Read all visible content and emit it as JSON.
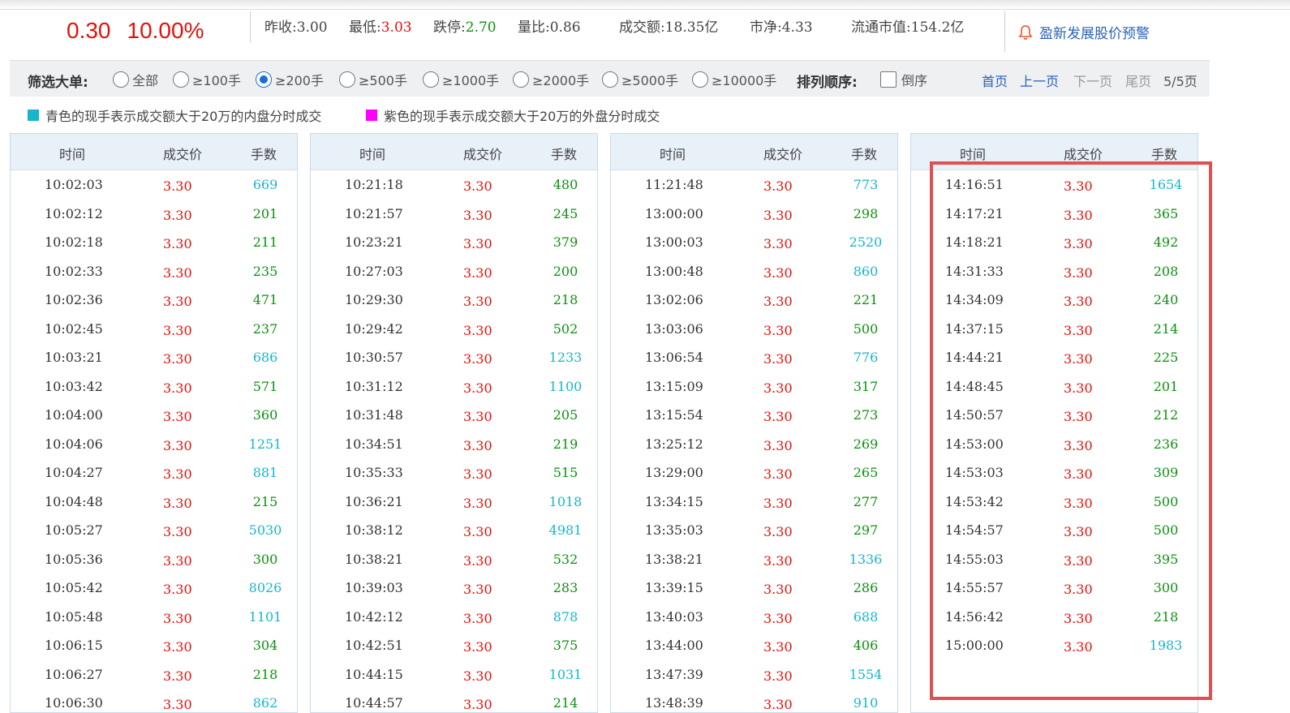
{
  "quote": {
    "change": "0.30",
    "change_pct": "10.00%"
  },
  "stats": {
    "prev_close_label": "昨收:",
    "prev_close": "3.00",
    "low_label": "最低:",
    "low": "3.03",
    "limit_down_label": "跌停:",
    "limit_down": "2.70",
    "volume_ratio_label": "量比:",
    "volume_ratio": "0.86",
    "turnover_label": "成交额:",
    "turnover": "18.35亿",
    "pb_label": "市净:",
    "pb": "4.33",
    "float_cap_label": "流通市值:",
    "float_cap": "154.2亿"
  },
  "alert": {
    "label": "盈新发展股价预警",
    "icon": "bell-icon"
  },
  "filter": {
    "label": "筛选大单:",
    "options": [
      "全部",
      "≥100手",
      "≥200手",
      "≥500手",
      "≥1000手",
      "≥2000手",
      "≥5000手",
      "≥10000手"
    ],
    "selected_index": 2,
    "sort_label": "排列顺序:",
    "reverse_label": "倒序"
  },
  "pager": {
    "first": "首页",
    "prev": "上一页",
    "next": "下一页",
    "last": "尾页",
    "info": "5/5页"
  },
  "legend": {
    "cyan": "青色的现手表示成交额大于20万的内盘分时成交",
    "magenta": "紫色的现手表示成交额大于20万的外盘分时成交"
  },
  "colors": {
    "red": "#e4110b",
    "green": "#0c9010",
    "cyan": "#17b5c9",
    "magenta": "#ff00ff",
    "link": "#2a62b7",
    "highlight": "#e0504e"
  },
  "headers": {
    "time": "时间",
    "price": "成交价",
    "volume": "手数"
  },
  "panels": [
    {
      "rows": [
        {
          "time": "10:02:03",
          "price": "3.30",
          "vol": "669",
          "c": "cyan"
        },
        {
          "time": "10:02:12",
          "price": "3.30",
          "vol": "201",
          "c": "green"
        },
        {
          "time": "10:02:18",
          "price": "3.30",
          "vol": "211",
          "c": "green"
        },
        {
          "time": "10:02:33",
          "price": "3.30",
          "vol": "235",
          "c": "green"
        },
        {
          "time": "10:02:36",
          "price": "3.30",
          "vol": "471",
          "c": "green"
        },
        {
          "time": "10:02:45",
          "price": "3.30",
          "vol": "237",
          "c": "green"
        },
        {
          "time": "10:03:21",
          "price": "3.30",
          "vol": "686",
          "c": "cyan"
        },
        {
          "time": "10:03:42",
          "price": "3.30",
          "vol": "571",
          "c": "green"
        },
        {
          "time": "10:04:00",
          "price": "3.30",
          "vol": "360",
          "c": "green"
        },
        {
          "time": "10:04:06",
          "price": "3.30",
          "vol": "1251",
          "c": "cyan"
        },
        {
          "time": "10:04:27",
          "price": "3.30",
          "vol": "881",
          "c": "cyan"
        },
        {
          "time": "10:04:48",
          "price": "3.30",
          "vol": "215",
          "c": "green"
        },
        {
          "time": "10:05:27",
          "price": "3.30",
          "vol": "5030",
          "c": "cyan"
        },
        {
          "time": "10:05:36",
          "price": "3.30",
          "vol": "300",
          "c": "green"
        },
        {
          "time": "10:05:42",
          "price": "3.30",
          "vol": "8026",
          "c": "cyan"
        },
        {
          "time": "10:05:48",
          "price": "3.30",
          "vol": "1101",
          "c": "cyan"
        },
        {
          "time": "10:06:15",
          "price": "3.30",
          "vol": "304",
          "c": "green"
        },
        {
          "time": "10:06:27",
          "price": "3.30",
          "vol": "218",
          "c": "green"
        },
        {
          "time": "10:06:30",
          "price": "3.30",
          "vol": "862",
          "c": "cyan"
        }
      ]
    },
    {
      "rows": [
        {
          "time": "10:21:18",
          "price": "3.30",
          "vol": "480",
          "c": "green"
        },
        {
          "time": "10:21:57",
          "price": "3.30",
          "vol": "245",
          "c": "green"
        },
        {
          "time": "10:23:21",
          "price": "3.30",
          "vol": "379",
          "c": "green"
        },
        {
          "time": "10:27:03",
          "price": "3.30",
          "vol": "200",
          "c": "green"
        },
        {
          "time": "10:29:30",
          "price": "3.30",
          "vol": "218",
          "c": "green"
        },
        {
          "time": "10:29:42",
          "price": "3.30",
          "vol": "502",
          "c": "green"
        },
        {
          "time": "10:30:57",
          "price": "3.30",
          "vol": "1233",
          "c": "cyan"
        },
        {
          "time": "10:31:12",
          "price": "3.30",
          "vol": "1100",
          "c": "cyan"
        },
        {
          "time": "10:31:48",
          "price": "3.30",
          "vol": "205",
          "c": "green"
        },
        {
          "time": "10:34:51",
          "price": "3.30",
          "vol": "219",
          "c": "green"
        },
        {
          "time": "10:35:33",
          "price": "3.30",
          "vol": "515",
          "c": "green"
        },
        {
          "time": "10:36:21",
          "price": "3.30",
          "vol": "1018",
          "c": "cyan"
        },
        {
          "time": "10:38:12",
          "price": "3.30",
          "vol": "4981",
          "c": "cyan"
        },
        {
          "time": "10:38:21",
          "price": "3.30",
          "vol": "532",
          "c": "green"
        },
        {
          "time": "10:39:03",
          "price": "3.30",
          "vol": "283",
          "c": "green"
        },
        {
          "time": "10:42:12",
          "price": "3.30",
          "vol": "878",
          "c": "cyan"
        },
        {
          "time": "10:42:51",
          "price": "3.30",
          "vol": "375",
          "c": "green"
        },
        {
          "time": "10:44:15",
          "price": "3.30",
          "vol": "1031",
          "c": "cyan"
        },
        {
          "time": "10:44:57",
          "price": "3.30",
          "vol": "214",
          "c": "green"
        }
      ]
    },
    {
      "rows": [
        {
          "time": "11:21:48",
          "price": "3.30",
          "vol": "773",
          "c": "cyan"
        },
        {
          "time": "13:00:00",
          "price": "3.30",
          "vol": "298",
          "c": "green"
        },
        {
          "time": "13:00:03",
          "price": "3.30",
          "vol": "2520",
          "c": "cyan"
        },
        {
          "time": "13:00:48",
          "price": "3.30",
          "vol": "860",
          "c": "cyan"
        },
        {
          "time": "13:02:06",
          "price": "3.30",
          "vol": "221",
          "c": "green"
        },
        {
          "time": "13:03:06",
          "price": "3.30",
          "vol": "500",
          "c": "green"
        },
        {
          "time": "13:06:54",
          "price": "3.30",
          "vol": "776",
          "c": "cyan"
        },
        {
          "time": "13:15:09",
          "price": "3.30",
          "vol": "317",
          "c": "green"
        },
        {
          "time": "13:15:54",
          "price": "3.30",
          "vol": "273",
          "c": "green"
        },
        {
          "time": "13:25:12",
          "price": "3.30",
          "vol": "269",
          "c": "green"
        },
        {
          "time": "13:29:00",
          "price": "3.30",
          "vol": "265",
          "c": "green"
        },
        {
          "time": "13:34:15",
          "price": "3.30",
          "vol": "277",
          "c": "green"
        },
        {
          "time": "13:35:03",
          "price": "3.30",
          "vol": "297",
          "c": "green"
        },
        {
          "time": "13:38:21",
          "price": "3.30",
          "vol": "1336",
          "c": "cyan"
        },
        {
          "time": "13:39:15",
          "price": "3.30",
          "vol": "286",
          "c": "green"
        },
        {
          "time": "13:40:03",
          "price": "3.30",
          "vol": "688",
          "c": "cyan"
        },
        {
          "time": "13:44:00",
          "price": "3.30",
          "vol": "406",
          "c": "green"
        },
        {
          "time": "13:47:39",
          "price": "3.30",
          "vol": "1554",
          "c": "cyan"
        },
        {
          "time": "13:48:39",
          "price": "3.30",
          "vol": "910",
          "c": "cyan"
        }
      ]
    },
    {
      "rows": [
        {
          "time": "14:16:51",
          "price": "3.30",
          "vol": "1654",
          "c": "cyan"
        },
        {
          "time": "14:17:21",
          "price": "3.30",
          "vol": "365",
          "c": "green"
        },
        {
          "time": "14:18:21",
          "price": "3.30",
          "vol": "492",
          "c": "green"
        },
        {
          "time": "14:31:33",
          "price": "3.30",
          "vol": "208",
          "c": "green"
        },
        {
          "time": "14:34:09",
          "price": "3.30",
          "vol": "240",
          "c": "green"
        },
        {
          "time": "14:37:15",
          "price": "3.30",
          "vol": "214",
          "c": "green"
        },
        {
          "time": "14:44:21",
          "price": "3.30",
          "vol": "225",
          "c": "green"
        },
        {
          "time": "14:48:45",
          "price": "3.30",
          "vol": "201",
          "c": "green"
        },
        {
          "time": "14:50:57",
          "price": "3.30",
          "vol": "212",
          "c": "green"
        },
        {
          "time": "14:53:00",
          "price": "3.30",
          "vol": "236",
          "c": "green"
        },
        {
          "time": "14:53:03",
          "price": "3.30",
          "vol": "309",
          "c": "green"
        },
        {
          "time": "14:53:42",
          "price": "3.30",
          "vol": "500",
          "c": "green"
        },
        {
          "time": "14:54:57",
          "price": "3.30",
          "vol": "500",
          "c": "green"
        },
        {
          "time": "14:55:03",
          "price": "3.30",
          "vol": "395",
          "c": "green"
        },
        {
          "time": "14:55:57",
          "price": "3.30",
          "vol": "300",
          "c": "green"
        },
        {
          "time": "14:56:42",
          "price": "3.30",
          "vol": "218",
          "c": "green"
        },
        {
          "time": "15:00:00",
          "price": "3.30",
          "vol": "1983",
          "c": "cyan"
        }
      ]
    }
  ]
}
